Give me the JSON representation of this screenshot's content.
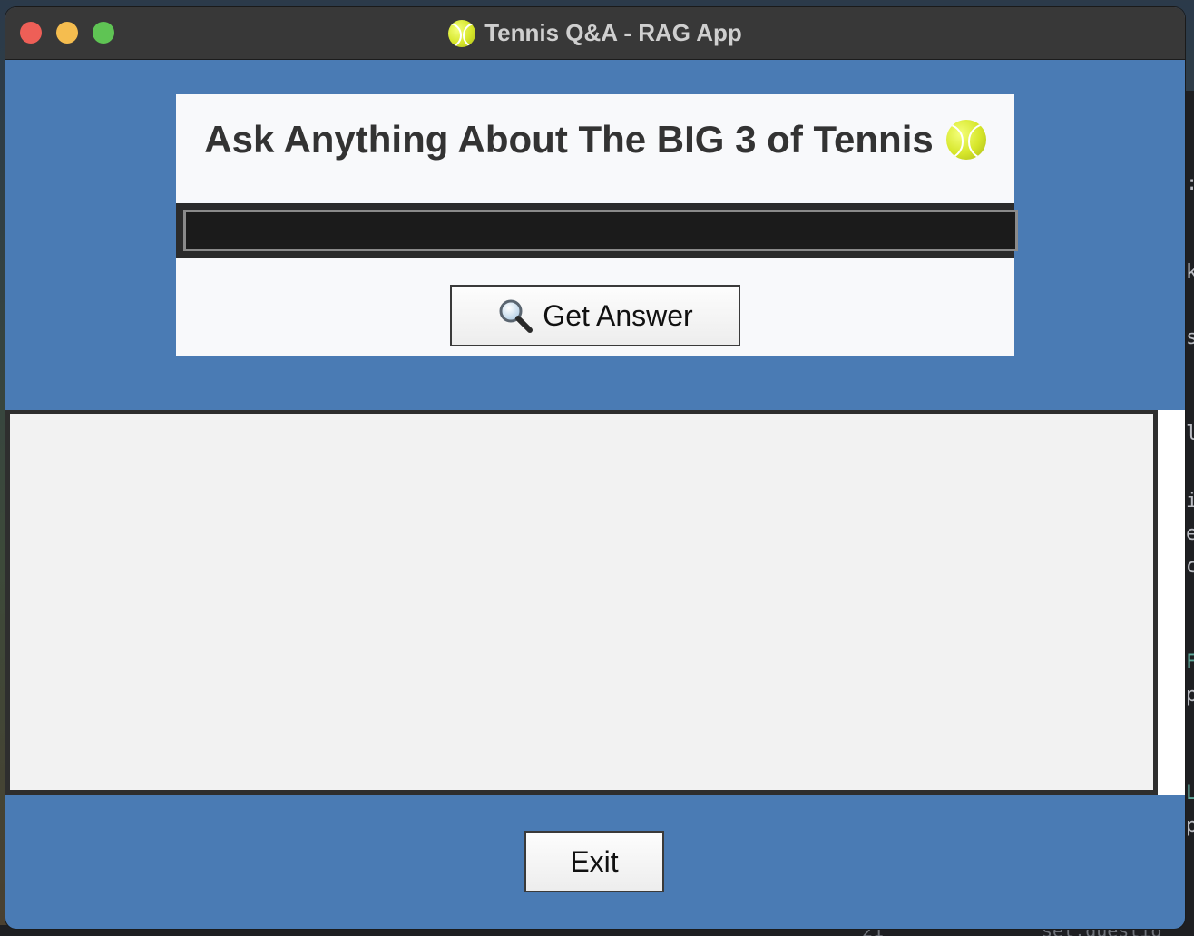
{
  "window": {
    "title": "Tennis Q&A - RAG App",
    "title_icon": "tennis-ball-icon"
  },
  "header": {
    "heading": "Ask Anything About The BIG 3 of Tennis",
    "heading_icon": "tennis-ball-icon"
  },
  "question": {
    "value": "",
    "placeholder": ""
  },
  "get_answer_button": {
    "label": "Get Answer",
    "icon": "magnifying-glass-icon"
  },
  "answer": {
    "text": ""
  },
  "exit_button": {
    "label": "Exit"
  },
  "background": {
    "code_lines": [
      ":",
      "k",
      "s",
      "l",
      "i",
      "e",
      "c",
      "F",
      "p",
      "L",
      "p"
    ],
    "bottom_text": [
      "21",
      "set.questio"
    ]
  },
  "colors": {
    "window_background": "#4a7bb4",
    "panel_background": "#f8f9fb",
    "input_background": "#1b1b1b",
    "answer_background": "#f2f2f2",
    "titlebar": "#383838"
  }
}
